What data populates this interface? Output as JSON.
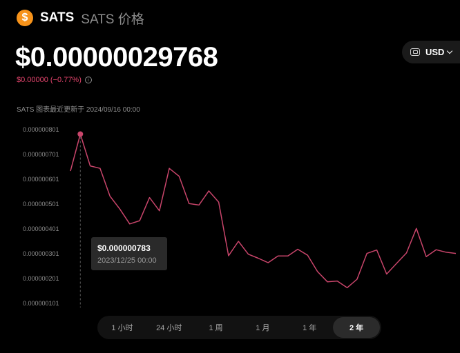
{
  "header": {
    "logo_glyph": "$",
    "symbol": "SATS",
    "name": "SATS 价格"
  },
  "price": "$0.00000029768",
  "change": {
    "text": "$0.00000 (−0.77%)",
    "color": "#e8466f",
    "info_icon": "info-icon"
  },
  "currency": {
    "label": "USD",
    "icon": "wallet-icon"
  },
  "updated": "SATS 图表最近更新于 2024/09/16 00:00",
  "tooltip": {
    "price": "$0.000000783",
    "date": "2023/12/25 00:00"
  },
  "ranges": [
    {
      "label": "1 小时",
      "active": false
    },
    {
      "label": "24 小时",
      "active": false
    },
    {
      "label": "1 周",
      "active": false
    },
    {
      "label": "1 月",
      "active": false
    },
    {
      "label": "1 年",
      "active": false
    },
    {
      "label": "2 年",
      "active": true
    }
  ],
  "colors": {
    "line": "#c9456b",
    "background": "#000000",
    "accent_logo": "#f7931a"
  },
  "chart_data": {
    "type": "line",
    "ylim": [
      1.01e-07,
      8.01e-07
    ],
    "ytick_values": [
      1.01e-07,
      2.01e-07,
      3.01e-07,
      4.01e-07,
      5.01e-07,
      6.01e-07,
      7.01e-07,
      8.01e-07
    ],
    "yticks": [
      "0.000000101",
      "0.000000201",
      "0.000000301",
      "0.000000401",
      "0.000000501",
      "0.000000601",
      "0.000000701",
      "0.000000801"
    ],
    "values": [
      6.34e-07,
      7.83e-07,
      6.55e-07,
      6.45e-07,
      5.33e-07,
      4.81e-07,
      4.21e-07,
      4.34e-07,
      5.27e-07,
      4.74e-07,
      6.45e-07,
      6.13e-07,
      5.03e-07,
      4.97e-07,
      5.54e-07,
      5.09e-07,
      2.93e-07,
      3.51e-07,
      2.99e-07,
      2.83e-07,
      2.65e-07,
      2.92e-07,
      2.92e-07,
      3.19e-07,
      2.95e-07,
      2.29e-07,
      1.88e-07,
      1.91e-07,
      1.64e-07,
      1.98e-07,
      3.02e-07,
      3.16e-07,
      2.19e-07,
      2.62e-07,
      3.04e-07,
      4.03e-07,
      2.89e-07,
      3.17e-07,
      3.07e-07,
      3.02e-07
    ],
    "highlight_index": 1,
    "grid": false
  }
}
